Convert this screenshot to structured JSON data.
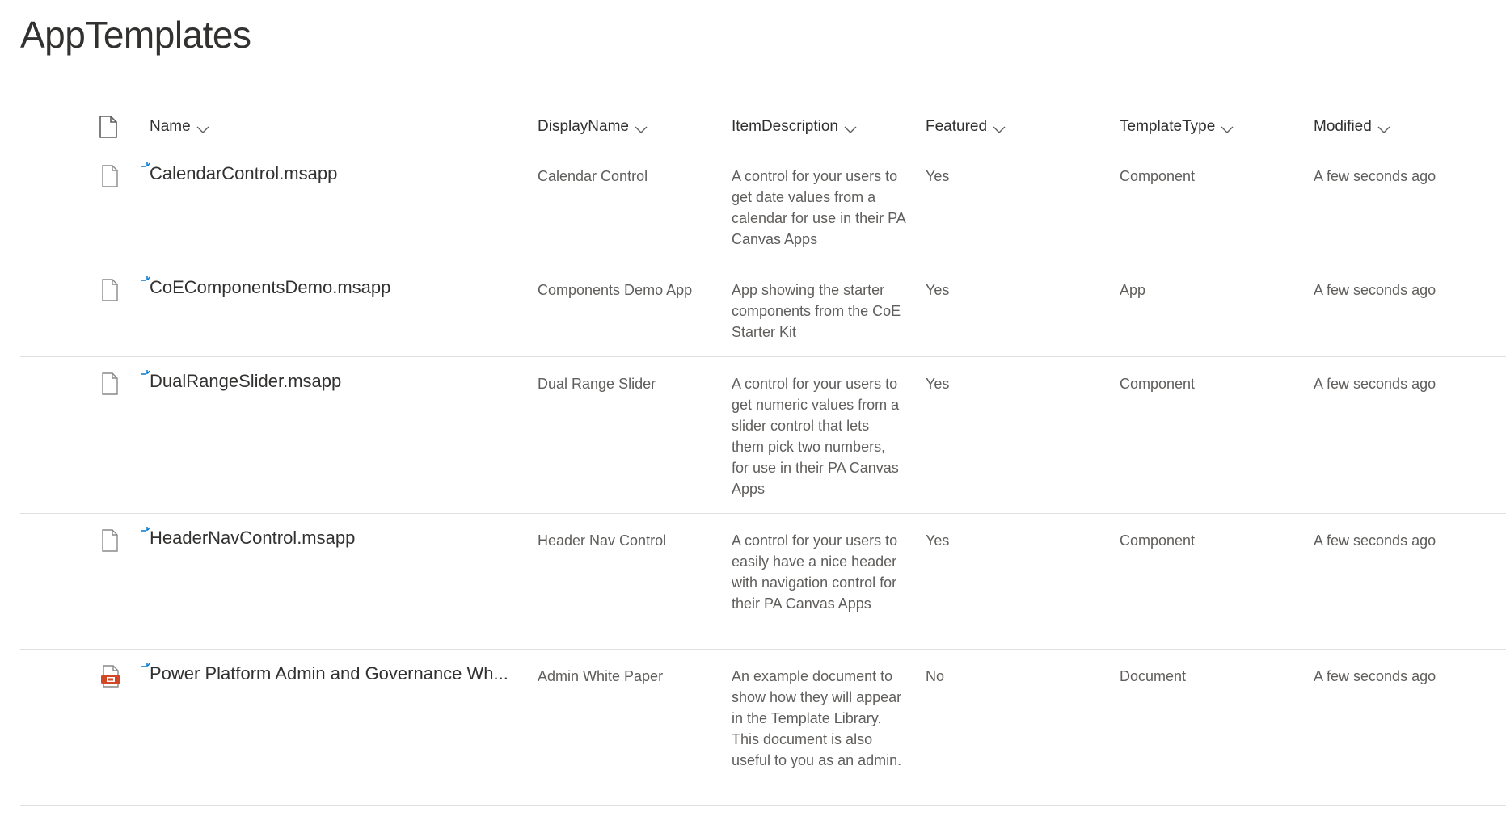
{
  "page": {
    "title": "AppTemplates"
  },
  "columns": {
    "name": "Name",
    "display_name": "DisplayName",
    "item_description": "ItemDescription",
    "featured": "Featured",
    "template_type": "TemplateType",
    "modified": "Modified"
  },
  "rows": [
    {
      "icon": "generic-file-icon",
      "name": "CalendarControl.msapp",
      "display_name": "Calendar Control",
      "item_description": "A control for your users to get date values from a calendar for use in their PA Canvas Apps",
      "featured": "Yes",
      "template_type": "Component",
      "modified": "A few seconds ago"
    },
    {
      "icon": "generic-file-icon",
      "name": "CoEComponentsDemo.msapp",
      "display_name": "Components Demo App",
      "item_description": "App showing the starter components from the CoE Starter Kit",
      "featured": "Yes",
      "template_type": "App",
      "modified": "A few seconds ago"
    },
    {
      "icon": "generic-file-icon",
      "name": "DualRangeSlider.msapp",
      "display_name": "Dual Range Slider",
      "item_description": "A control for your users to get numeric values from a slider control that lets them pick two numbers, for use in their PA Canvas Apps",
      "featured": "Yes",
      "template_type": "Component",
      "modified": "A few seconds ago"
    },
    {
      "icon": "generic-file-icon",
      "name": "HeaderNavControl.msapp",
      "display_name": "Header Nav Control",
      "item_description": "A control for your users to easily have a nice header with navigation control for their PA Canvas Apps",
      "featured": "Yes",
      "template_type": "Component",
      "modified": "A few seconds ago"
    },
    {
      "icon": "powerpoint-file-icon",
      "name": "Power Platform Admin and Governance Wh...",
      "display_name": "Admin White Paper",
      "item_description": "An example document to show how they will appear in the Template Library. This document is also useful to you as an admin.",
      "featured": "No",
      "template_type": "Document",
      "modified": "A few seconds ago"
    }
  ],
  "colors": {
    "text_primary": "#323130",
    "text_secondary": "#605e5c",
    "new_indicator": "#0078d4",
    "ppt_accent": "#d24726",
    "divider": "#e1dfdd"
  }
}
